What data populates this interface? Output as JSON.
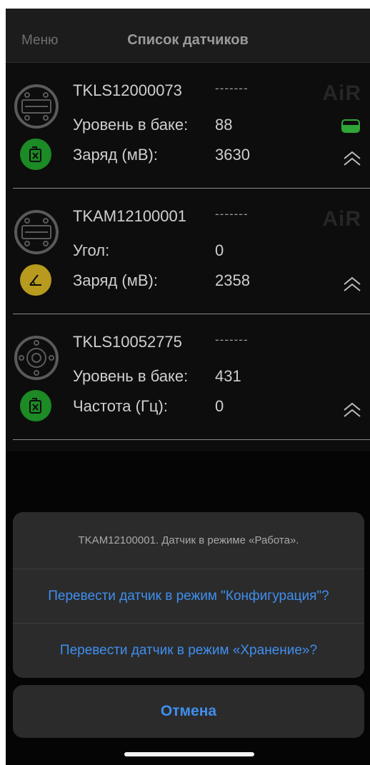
{
  "nav": {
    "menu_label": "Меню",
    "title": "Список датчиков"
  },
  "sensors": [
    {
      "id": "TKLS12000073",
      "status": "-------",
      "row2_label": "Уровень в баке:",
      "row2_value": "88",
      "row3_label": "Заряд (мВ):",
      "row3_value": "3630",
      "logo": "AiR",
      "battery_level": 0.6,
      "device_icon": "lls-sensor-icon",
      "status_icon": "fuel-can-icon",
      "status_color": "#1c8a25"
    },
    {
      "id": "TKAM12100001",
      "status": "-------",
      "row2_label": "Угол:",
      "row2_value": "0",
      "row3_label": "Заряд (мВ):",
      "row3_value": "2358",
      "logo": "AiR",
      "device_icon": "lls-sensor-icon",
      "status_icon": "angle-icon",
      "status_color": "#b79a1e"
    },
    {
      "id": "TKLS10052775",
      "status": "-------",
      "row2_label": "Уровень в баке:",
      "row2_value": "431",
      "row3_label": "Частота (Гц):",
      "row3_value": "0",
      "device_icon": "flange-sensor-icon",
      "status_icon": "fuel-can-icon",
      "status_color": "#1c8a25"
    }
  ],
  "action_sheet": {
    "message": "TKAM12100001. Датчик в режиме «Работа».",
    "actions": [
      "Перевести датчик в режим \"Конфигурация\"?",
      "Перевести датчик в режим «Хранение»?"
    ],
    "cancel_label": "Отмена"
  },
  "colors": {
    "accent_blue": "#3f8ff0",
    "battery_green": "#2fa637",
    "background": "#0d0d0d"
  }
}
